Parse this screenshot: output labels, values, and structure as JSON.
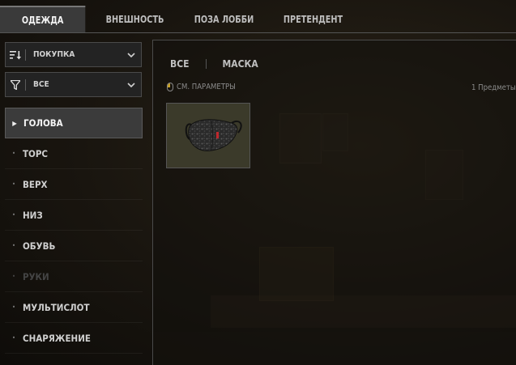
{
  "top_tabs": [
    {
      "label": "ОДЕЖДА",
      "active": true
    },
    {
      "label": "ВНЕШНОСТЬ",
      "active": false
    },
    {
      "label": "ПОЗА ЛОББИ",
      "active": false
    },
    {
      "label": "ПРЕТЕНДЕНТ",
      "active": false
    }
  ],
  "dropdowns": {
    "sort": {
      "label": "ПОКУПКА",
      "icon": "sort-icon"
    },
    "filter": {
      "label": "ВСЕ",
      "icon": "filter-icon"
    }
  },
  "categories": [
    {
      "label": "ГОЛОВА",
      "active": true,
      "disabled": false
    },
    {
      "label": "ТОРС",
      "active": false,
      "disabled": false
    },
    {
      "label": "ВЕРХ",
      "active": false,
      "disabled": false
    },
    {
      "label": "НИЗ",
      "active": false,
      "disabled": false
    },
    {
      "label": "ОБУВЬ",
      "active": false,
      "disabled": false
    },
    {
      "label": "РУКИ",
      "active": false,
      "disabled": true
    },
    {
      "label": "МУЛЬТИСЛОТ",
      "active": false,
      "disabled": false
    },
    {
      "label": "СНАРЯЖЕНИЕ",
      "active": false,
      "disabled": false
    }
  ],
  "sub_tabs": [
    {
      "label": "ВСЕ"
    },
    {
      "label": "МАСКА"
    }
  ],
  "params": {
    "label": "СМ. ПАРАМЕТРЫ",
    "icon": "mouse-icon"
  },
  "item_count": "1 Предметы",
  "items": [
    {
      "icon": "face-mask-icon"
    }
  ],
  "colors": {
    "active_tab_bg": "#3a3a3a",
    "panel_border": "#4a4a4a",
    "mask_accent": "#c0282d",
    "item_bg": "#3b3a2a"
  }
}
